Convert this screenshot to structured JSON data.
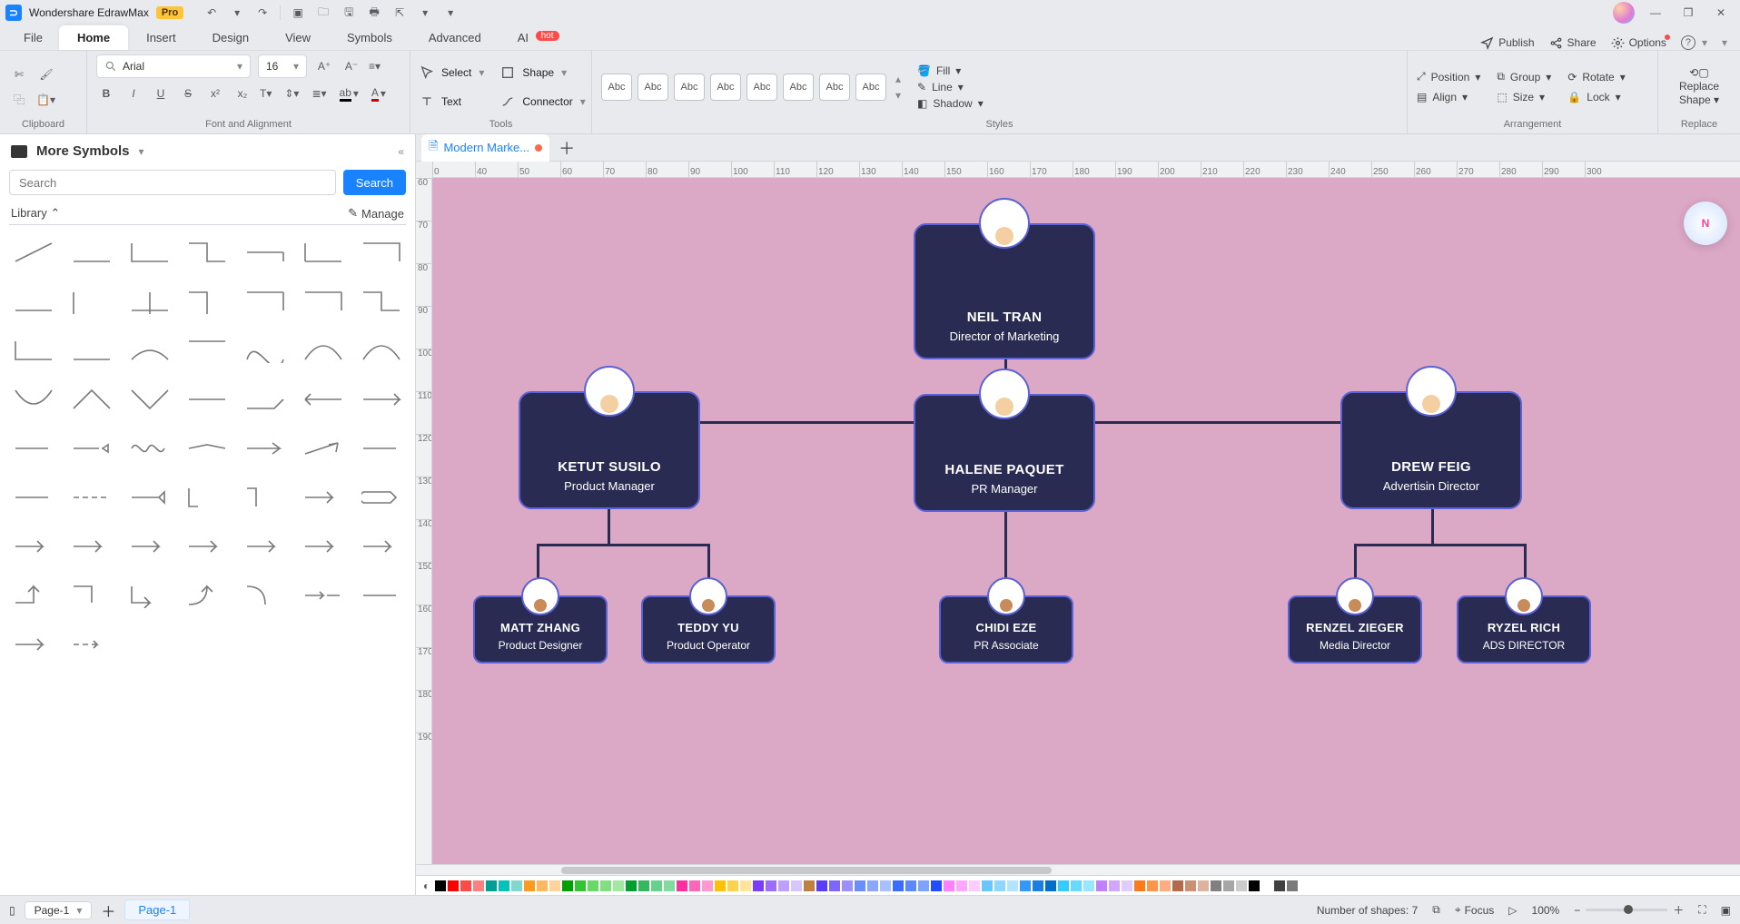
{
  "app": {
    "name": "Wondershare EdrawMax",
    "pro_badge": "Pro"
  },
  "menus": {
    "file": "File",
    "home": "Home",
    "insert": "Insert",
    "design": "Design",
    "view": "View",
    "symbols": "Symbols",
    "advanced": "Advanced",
    "ai": "AI",
    "ai_badge": "hot"
  },
  "menubar_right": {
    "publish": "Publish",
    "share": "Share",
    "options": "Options"
  },
  "ribbon": {
    "clipboard": {
      "label": "Clipboard"
    },
    "font": {
      "label": "Font and Alignment",
      "font_name": "Arial",
      "font_size": "16"
    },
    "tools": {
      "label": "Tools",
      "select": "Select",
      "text": "Text",
      "shape": "Shape",
      "connector": "Connector"
    },
    "styles": {
      "label": "Styles",
      "swatch": "Abc",
      "fill": "Fill",
      "line": "Line",
      "shadow": "Shadow"
    },
    "arrangement": {
      "label": "Arrangement",
      "position": "Position",
      "align": "Align",
      "group": "Group",
      "size": "Size",
      "rotate": "Rotate",
      "lock": "Lock"
    },
    "replace": {
      "label": "Replace",
      "btn_line1": "Replace",
      "btn_line2": "Shape"
    }
  },
  "left_panel": {
    "title": "More Symbols",
    "search_placeholder": "Search",
    "search_btn": "Search",
    "library_label": "Library",
    "manage_label": "Manage"
  },
  "doc_tabs": {
    "active_name": "Modern Marke..."
  },
  "ruler_h": [
    "0",
    "40",
    "50",
    "60",
    "70",
    "80",
    "90",
    "100",
    "110",
    "120",
    "130",
    "140",
    "150",
    "160",
    "170",
    "180",
    "190",
    "200",
    "210",
    "220",
    "230",
    "240",
    "250",
    "260",
    "270",
    "280",
    "290",
    "300"
  ],
  "ruler_v": [
    "60",
    "70",
    "80",
    "90",
    "100",
    "110",
    "120",
    "130",
    "140",
    "150",
    "160",
    "170",
    "180",
    "190"
  ],
  "org_chart": {
    "root": {
      "name": "NEIL TRAN",
      "title": "Director of Marketing"
    },
    "children": [
      {
        "name": "KETUT SUSILO",
        "title": "Product Manager",
        "children": [
          {
            "name": "MATT ZHANG",
            "title": "Product Designer"
          },
          {
            "name": "TEDDY YU",
            "title": "Product Operator"
          }
        ]
      },
      {
        "name": "HALENE PAQUET",
        "title": "PR Manager",
        "children": [
          {
            "name": "CHIDI EZE",
            "title": "PR Associate"
          }
        ]
      },
      {
        "name": "DREW FEIG",
        "title": "Advertisin Director",
        "children": [
          {
            "name": "RENZEL ZIEGER",
            "title": "Media Director"
          },
          {
            "name": "RYZEL RICH",
            "title": "ADS DIRECTOR"
          }
        ]
      }
    ]
  },
  "color_strip": [
    "#000000",
    "#ff0000",
    "#ff4a4a",
    "#ff8080",
    "#009f95",
    "#00c4b8",
    "#80d7d0",
    "#ff9a1f",
    "#ffb85d",
    "#ffd39b",
    "#00a000",
    "#33c433",
    "#66d966",
    "#80e080",
    "#a0eaa0",
    "#009f30",
    "#33b85d",
    "#66d18a",
    "#80dba0",
    "#ff2fa0",
    "#ff66b8",
    "#ff99d0",
    "#ffc000",
    "#ffd24d",
    "#ffe499",
    "#7a3cff",
    "#9b6eff",
    "#bc9fff",
    "#d6c6ff",
    "#c08040",
    "#5a3cff",
    "#7b66ff",
    "#9c90ff",
    "#6a8dff",
    "#8aa6ff",
    "#aabfff",
    "#3a6dff",
    "#5c88ff",
    "#7ea3ff",
    "#1f4dff",
    "#ff80ff",
    "#ffa6ff",
    "#ffccff",
    "#66c8ff",
    "#8cd6ff",
    "#b2e4ff",
    "#3399ff",
    "#1a7fe0",
    "#006fcc",
    "#33ccff",
    "#66d9ff",
    "#99e6ff",
    "#c080ff",
    "#d0a6ff",
    "#e0ccff",
    "#ff7a1a",
    "#ff944d",
    "#ffad80",
    "#b36b4a",
    "#cc8f73",
    "#ddb39d",
    "#808080",
    "#a6a6a6",
    "#cccccc",
    "#000000",
    "#ffffff",
    "#404040",
    "#7a7a7a"
  ],
  "status": {
    "page_select": "Page-1",
    "page_tab": "Page-1",
    "shapes_count_label": "Number of shapes: 7",
    "focus": "Focus",
    "zoom": "100%"
  },
  "float_icon": "N"
}
